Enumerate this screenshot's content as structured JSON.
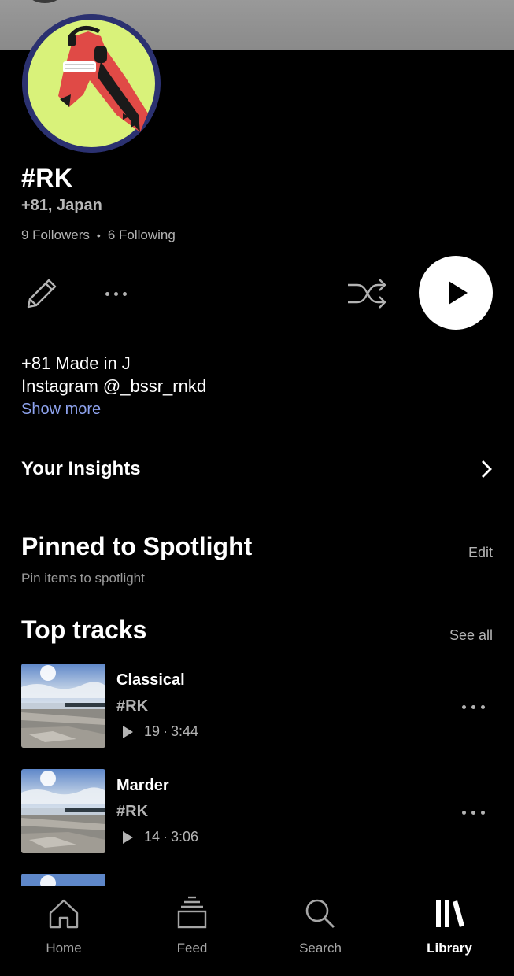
{
  "profile": {
    "name": "#RK",
    "location": "+81, Japan",
    "followers": "9 Followers",
    "separator": "•",
    "following": "6 Following",
    "bio_line_1": "+81 Made in J",
    "bio_line_2": "Instagram @_bssr_rnkd",
    "show_more": "Show more"
  },
  "actions": {
    "edit_icon": "pencil-icon",
    "more_icon": "more-horizontal-icon",
    "shuffle_icon": "shuffle-icon",
    "play_icon": "play-icon"
  },
  "insights": {
    "title": "Your Insights",
    "icon": "chevron-right-icon"
  },
  "pinned": {
    "title": "Pinned to Spotlight",
    "edit": "Edit",
    "subtitle": "Pin items to spotlight"
  },
  "top_tracks": {
    "title": "Top tracks",
    "see_all": "See all",
    "items": [
      {
        "title": "Classical",
        "artist": "#RK",
        "plays": "19",
        "dot": "·",
        "duration": "3:44"
      },
      {
        "title": "Marder",
        "artist": "#RK",
        "plays": "14",
        "dot": "·",
        "duration": "3:06"
      }
    ]
  },
  "tabs": [
    {
      "label": "Home",
      "icon": "home-icon",
      "active": false
    },
    {
      "label": "Feed",
      "icon": "feed-icon",
      "active": false
    },
    {
      "label": "Search",
      "icon": "search-icon",
      "active": false
    },
    {
      "label": "Library",
      "icon": "library-icon",
      "active": true
    }
  ],
  "colors": {
    "background": "#000000",
    "link": "#8ea3ee",
    "secondary_text": "#b3b3b3",
    "avatar_bg": "#d9f27a"
  }
}
